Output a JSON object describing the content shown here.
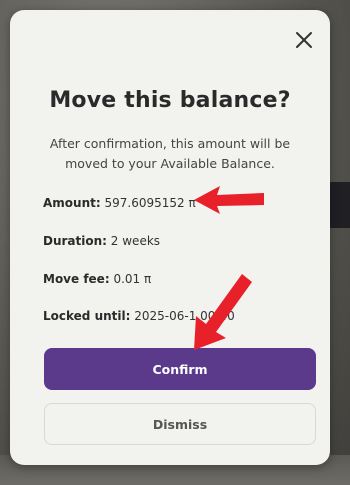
{
  "dialog": {
    "title": "Move this balance?",
    "subtitle": "After confirmation, this amount will be moved to your Available Balance.",
    "close_icon": "close-icon"
  },
  "details": [
    {
      "label": "Amount:",
      "value": "597.6095152 π"
    },
    {
      "label": "Duration:",
      "value": "2 weeks"
    },
    {
      "label": "Move fee:",
      "value": "0.01 π"
    },
    {
      "label": "Locked until:",
      "value": "2025-06-1 00:40"
    }
  ],
  "buttons": {
    "confirm": "Confirm",
    "dismiss": "Dismiss"
  },
  "colors": {
    "accent": "#5b3a8c",
    "annotation_arrow": "#e8202a"
  }
}
